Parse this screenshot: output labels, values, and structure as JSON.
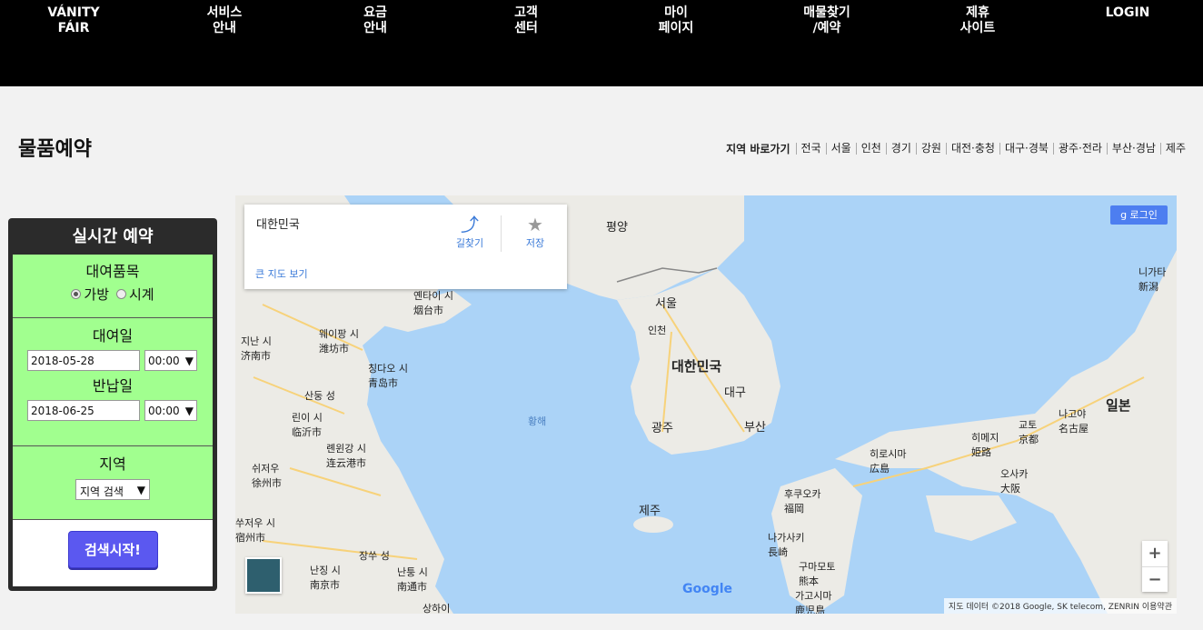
{
  "nav": {
    "brand": "VÁNITY\nFÁIR",
    "items": [
      "서비스\n안내",
      "요금\n안내",
      "고객\n센터",
      "마이\n페이지",
      "매물찾기\n/예약",
      "제휴\n사이트"
    ],
    "login": "LOGIN"
  },
  "page": {
    "title": "물품예약",
    "region_lead": "지역 바로가기",
    "regions": [
      "전국",
      "서울",
      "인천",
      "경기",
      "강원",
      "대전·충청",
      "대구·경북",
      "광주·전라",
      "부산·경남",
      "제주"
    ]
  },
  "panel": {
    "title": "실시간 예약",
    "items_label": "대여품목",
    "item_options": [
      "가방",
      "시계"
    ],
    "rent_label": "대여일",
    "rent_date": "2018-05-28",
    "rent_time": "00:00",
    "return_label": "반납일",
    "return_date": "2018-06-25",
    "return_time": "00:00",
    "region_label": "지역",
    "region_select": "지역 검색",
    "search_button": "검색시작!"
  },
  "map": {
    "card_name": "대한민국",
    "directions": "길찾기",
    "save": "저장",
    "bigger_map": "큰 지도 보기",
    "login": "로그인",
    "zoom_in": "+",
    "zoom_out": "−",
    "google": "Google",
    "attribution": "지도 데이터 ©2018 Google, SK telecom, ZENRIN   이용약관",
    "labels": {
      "pyongyang": "평양",
      "seoul": "서울",
      "incheon": "인천",
      "korea": "대한민국",
      "daegu": "대구",
      "gwangju": "광주",
      "busan": "부산",
      "jeju": "제주",
      "yellow_sea": "황해",
      "yantai": "옌타이 시\n烟台市",
      "weifang": "웨이팡 시\n潍坊市",
      "jinan": "지난 시\n济南市",
      "qingdao": "칭다오 시\n青岛市",
      "shandong": "산둥 성",
      "linyi": "린이 시\n临沂市",
      "lianyungang": "롄윈강 시\n连云港市",
      "xuzhou": "쉬저우\n徐州市",
      "suzhou": "쑤저우 시\n宿州市",
      "jiangsu": "장쑤 성",
      "nanjing": "난징 시\n南京市",
      "nantong": "난퉁 시\n南通市",
      "shanghai": "상하이",
      "hiroshima": "히로시마\n広島",
      "fukuoka": "후쿠오카\n福岡",
      "nagasaki": "나가사키\n長崎",
      "kumamoto": "구마모토\n熊本",
      "kagoshima": "가고시마\n鹿児島",
      "himeji": "히메지\n姫路",
      "kyoto": "교토\n京都",
      "osaka": "오사카\n大阪",
      "nagoya": "나고야\n名古屋",
      "japan": "일본",
      "niigata": "니가타\n新潟"
    }
  }
}
